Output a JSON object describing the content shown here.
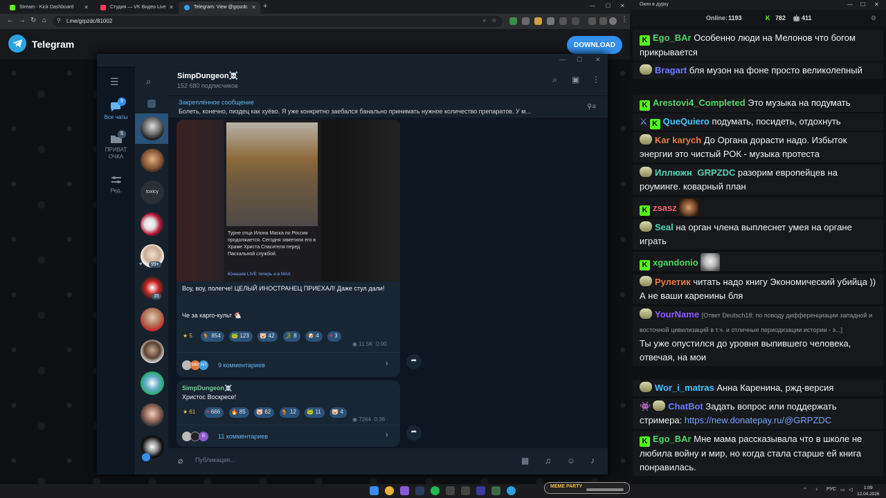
{
  "browser": {
    "tabs": [
      {
        "label": "Stream - Kick Dashboard",
        "color": "#53fc18"
      },
      {
        "label": "Студия — VK Видео Live",
        "color": "#ff3b5c"
      },
      {
        "label": "Telegram: View @grpzdc",
        "color": "#2aa3e1"
      }
    ],
    "url": "t.me/grpzdc/81002"
  },
  "telegram_web": {
    "brand": "Telegram",
    "download_label": "DOWNLOAD"
  },
  "tg": {
    "folders": [
      {
        "label": "Все чаты",
        "badge": "9"
      },
      {
        "label": "ПРИВАТ ОЧКА",
        "badge": "5"
      },
      {
        "label": "Ред.",
        "badge": ""
      }
    ],
    "chat_badges": {
      "unread_99": "99+",
      "unread_35": "35"
    },
    "channel": {
      "name": "SimpDungeon☠️",
      "subscribers": "152 680 подписчиков"
    },
    "pinned": {
      "title": "Закреплённое сообщение",
      "text": "Болеть, конечно, пиздец как хуёво. Я уже конкретно заебался банально принимать нужное количество препаратов. У м..."
    },
    "post1": {
      "image_caption": "Турне отца Илона Маска по России продолжается. Сегодня заметили его в Храме Христа Спасителя перед Пасхальной службой.",
      "image_source": "Юнашев LIVE теперь и в MAX",
      "text1": "Воу, воу, полегче! ЦЕЛЫЙ ИНОСТРАНЕЦ ПРИЕХАЛ! Даже стул дали!",
      "text2": "Че за карго-культ 🐔",
      "reactions": [
        {
          "emoji": "★",
          "count": "5",
          "gold": true
        },
        {
          "emoji": "🐓",
          "count": "854"
        },
        {
          "emoji": "🐸",
          "count": "123"
        },
        {
          "emoji": "🐷",
          "count": "42"
        },
        {
          "emoji": "🐊",
          "count": "8"
        },
        {
          "emoji": "🐶",
          "count": "4"
        },
        {
          "emoji": "♥",
          "count": "3"
        }
      ],
      "views": "11.5K",
      "time": "0:00",
      "comment_avatars": [
        "ММ",
        "АП"
      ],
      "comments": "9 комментариев"
    },
    "post2": {
      "author": "SimpDungeon☠️",
      "text": "Христос Воскресе!",
      "reactions": [
        {
          "emoji": "★",
          "count": "61",
          "gold": true
        },
        {
          "emoji": "♥",
          "count": "666"
        },
        {
          "emoji": "🔥",
          "count": "85"
        },
        {
          "emoji": "🐷",
          "count": "62"
        },
        {
          "emoji": "🐓",
          "count": "12"
        },
        {
          "emoji": "🐸",
          "count": "11"
        },
        {
          "emoji": "🐷",
          "count": "4"
        }
      ],
      "views": "7264",
      "time": "0:36",
      "comment_avatars": [
        "В"
      ],
      "comments": "11 комментариев"
    },
    "composer_placeholder": "Публикация..."
  },
  "stream": {
    "window_title": "Окно в дурку",
    "online_label": "Online:",
    "online_count": "1193",
    "stat_a": "782",
    "stat_b": "411",
    "messages": [
      {
        "user": "Ego_BAr",
        "color": "#4fd66a",
        "badge": "k",
        "text": "Особенно люди на Мелонов что богом прикрывается"
      },
      {
        "user": "Bragart",
        "color": "#6c7bff",
        "badge": "b",
        "text": "бля музон на фоне просто великолепный"
      },
      {
        "user": "Arestovi4_Completed",
        "color": "#4fd66a",
        "badge": "k",
        "text": "Это музыка на подумать"
      },
      {
        "user": "QueQuiero",
        "color": "#43c6ff",
        "badge": "k2",
        "text": "подумать, посидеть, отдохнуть"
      },
      {
        "user": "Kar karych",
        "color": "#e97b4a",
        "badge": "b",
        "text": "До Органа дорасти надо. Избыток энергии это чистый РОК - музыка протеста"
      },
      {
        "user": "Иллюжн",
        "user2": "GRPZDC",
        "color": "#4fd6b0",
        "badge": "b",
        "text": "разорим европейцев на роуминге. коварный план"
      },
      {
        "user": "zsasz",
        "color": "#ff5b6e",
        "badge": "k",
        "text": "",
        "emote": "face"
      },
      {
        "user": "Seal",
        "color": "#4fd6b0",
        "badge": "b",
        "text": "на орган члена выплеснет умея на органе играть"
      },
      {
        "user": "xgandonio",
        "color": "#4fd66a",
        "badge": "k",
        "text": "",
        "emote": "cat"
      },
      {
        "user": "Рулетик",
        "color": "#e97b4a",
        "badge": "b",
        "text": "читать надо книгу Экономический убийца )) А не ваши каренины бля"
      },
      {
        "user": "YourName",
        "color": "#8b5bff",
        "badge": "b",
        "reply": "[Ответ Deutsch18: по поводу дифференциации западной и восточной цивилизаций в т.ч. и отличные периодизации истории - э...]",
        "text": "Ты уже опустился до уровня выпившего человека, отвечая, на мои"
      },
      {
        "user": "Wor_i_matras",
        "color": "#43c6ff",
        "badge": "b",
        "text": "Анна Каренина, ржд-версия"
      },
      {
        "user": "ChatBot",
        "color": "#6c7bff",
        "badge": "bot",
        "text": "Задать вопрос или поддержать стримера:",
        "link": "https://new.donatepay.ru/@GRPZDC"
      },
      {
        "user": "Ego_BAr",
        "color": "#4fd66a",
        "badge": "k",
        "text": "Мне мама рассказывала что в школе не любила войну и мир, но когда стала старше ей книга понравилась."
      }
    ]
  },
  "taskbar": {
    "meme_party": "MEME PARTY",
    "lang": "РУС",
    "time": "1:09",
    "date": "12.04.2026"
  }
}
